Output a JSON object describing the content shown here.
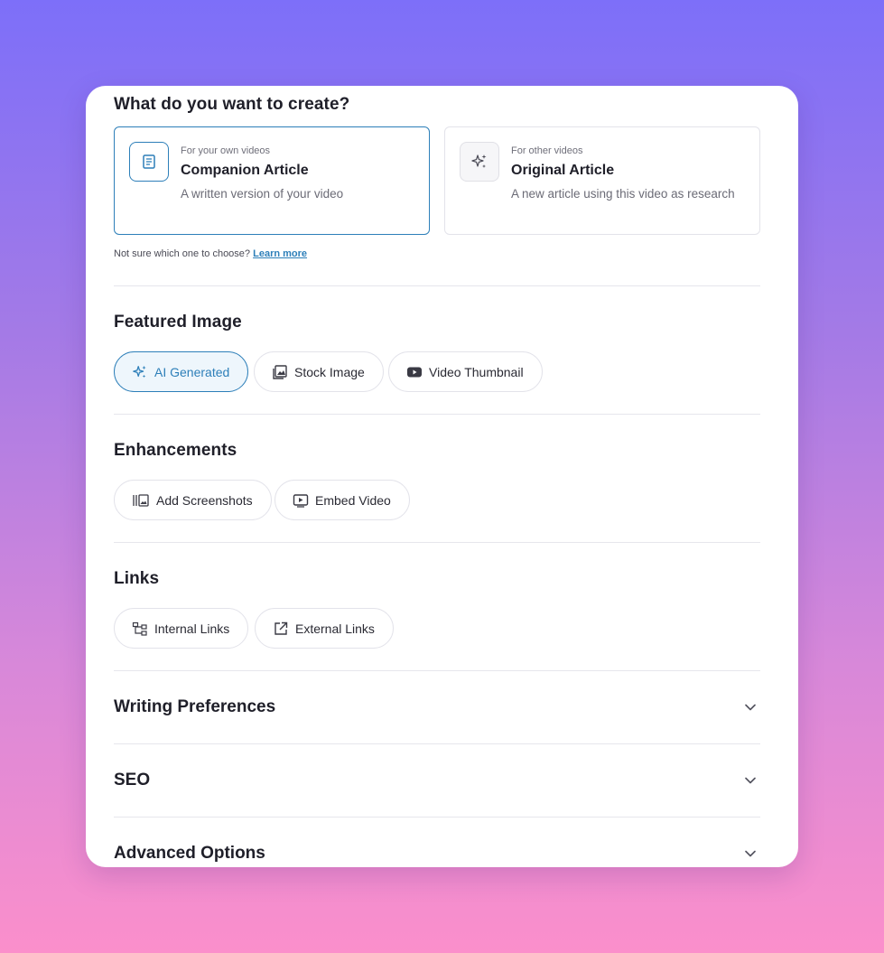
{
  "create": {
    "title": "What do you want to create?",
    "options": [
      {
        "small": "For your own videos",
        "title": "Companion Article",
        "desc": "A written version of your video",
        "icon": "document-icon",
        "selected": true
      },
      {
        "small": "For other videos",
        "title": "Original Article",
        "desc": "A new article using this video as research",
        "icon": "sparkle-icon",
        "selected": false
      }
    ],
    "hint": "Not sure which one to choose?",
    "learn_more": "Learn more"
  },
  "featured_image": {
    "title": "Featured Image",
    "options": [
      {
        "label": "AI Generated",
        "icon": "sparkle-icon",
        "active": true
      },
      {
        "label": "Stock Image",
        "icon": "image-stack-icon",
        "active": false
      },
      {
        "label": "Video Thumbnail",
        "icon": "youtube-icon",
        "active": false
      }
    ]
  },
  "enhancements": {
    "title": "Enhancements",
    "options": [
      {
        "label": "Add Screenshots",
        "icon": "screenshots-icon"
      },
      {
        "label": "Embed Video",
        "icon": "embed-video-icon"
      }
    ]
  },
  "links": {
    "title": "Links",
    "options": [
      {
        "label": "Internal Links",
        "icon": "sitemap-icon"
      },
      {
        "label": "External Links",
        "icon": "external-link-icon"
      }
    ]
  },
  "accordions": {
    "writing": "Writing Preferences",
    "seo": "SEO",
    "advanced": "Advanced Options"
  },
  "colors": {
    "accent": "#2d7fb9",
    "accent_bg": "#eef6fc",
    "text": "#1f1f29",
    "muted": "#6b6b76"
  }
}
